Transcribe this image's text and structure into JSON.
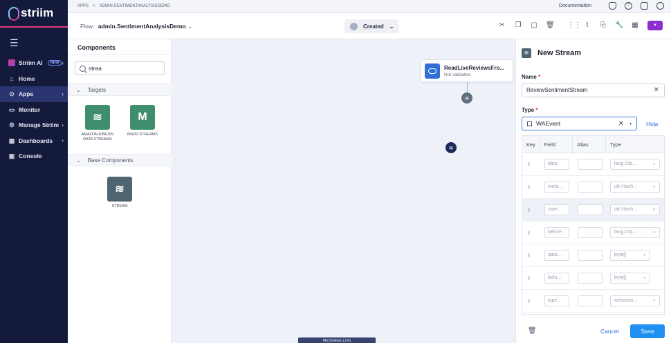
{
  "sidebar": {
    "brand": "striim",
    "menu_icon": "☰",
    "items": [
      {
        "label": "Striim AI",
        "badge": "NEW",
        "chevron": "›"
      },
      {
        "label": "Home",
        "icon": "⌂"
      },
      {
        "label": "Apps",
        "icon": "⊙",
        "chevron": "›"
      },
      {
        "label": "Monitor",
        "icon": "▭"
      },
      {
        "label": "Manage Striim",
        "icon": "⚙",
        "chevron": "›"
      },
      {
        "label": "Dashboards",
        "icon": "▦",
        "chevron": "›"
      },
      {
        "label": "Console",
        "icon": "▣"
      }
    ]
  },
  "topbar": {
    "crumb_apps": "APPS",
    "crumb_sep": ">",
    "crumb_app": "ADMIN.SENTIMENTANALYSISDEMO",
    "documentation": "Documentation"
  },
  "flowbar": {
    "flow_label": "Flow:",
    "flow_name": "admin.SentimentAnalysisDemo",
    "flow_caret": "⌄",
    "status": "Created",
    "status_caret": "⌄"
  },
  "components": {
    "title": "Components",
    "search_value": "strea",
    "sections": [
      {
        "label": "Targets",
        "caret": "⌄"
      },
      {
        "label": "Base Components",
        "caret": "⌄"
      }
    ],
    "tiles": [
      {
        "label": "AMAZON KINESIS DATA STREAMS",
        "glyph": "≋",
        "color": "#3f8f6e"
      },
      {
        "label": "MAPR STREAMS",
        "glyph": "M",
        "color": "#3f8f6e"
      },
      {
        "label": "STREAM",
        "glyph": "≋",
        "color": "#4e6571"
      }
    ]
  },
  "canvas": {
    "source_title": "ReadLiveReviewsFro...",
    "source_status": "Not validated",
    "stream_glyph": "≋",
    "message_log": "MESSAGE LOG"
  },
  "panel": {
    "title": "New Stream",
    "name_label": "Name",
    "name_value": "ReviewSentimentStream",
    "type_label": "Type",
    "type_value": "WAEvent",
    "required_mark": "*",
    "clear_glyph": "✕",
    "caret_glyph": "▾",
    "key_glyph": "⚷",
    "hide_label": "Hide",
    "columns": [
      "Key",
      "Field",
      "Alias",
      "Type"
    ],
    "rows": [
      {
        "field": "data",
        "type": "lang.Obj..."
      },
      {
        "field": "meta...",
        "type": "util.Hash..."
      },
      {
        "field": "user...",
        "type": "util.Hash..."
      },
      {
        "field": "before",
        "type": "lang.Obj..."
      },
      {
        "field": "data...",
        "type": "byte[]"
      },
      {
        "field": "befo...",
        "type": "byte[]"
      },
      {
        "field": "type...",
        "type": "webactio..."
      }
    ],
    "trash_glyph": "🗑",
    "cancel_label": "Cancel",
    "save_label": "Save"
  }
}
